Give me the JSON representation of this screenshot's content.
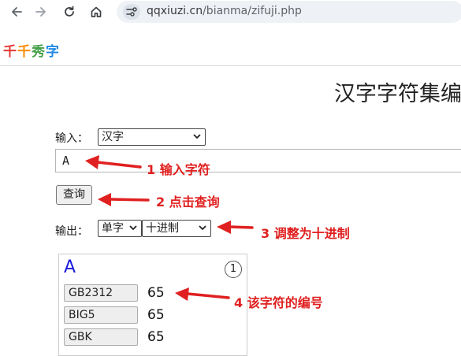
{
  "browser": {
    "url_host": "qqxiuzi.cn",
    "url_path": "/bianma/zifuji.php"
  },
  "site": {
    "logo_chars": [
      {
        "ch": "千",
        "color": "#e53935"
      },
      {
        "ch": "千",
        "color": "#fb8c00"
      },
      {
        "ch": "秀",
        "color": "#43a047"
      },
      {
        "ch": "字",
        "color": "#1e88e5"
      }
    ],
    "page_title": "汉字字符集编"
  },
  "form": {
    "input_label": "输入：",
    "input_type_value": "汉字",
    "input_value": "A",
    "query_button": "查询",
    "output_label": "输出：",
    "output_mode_value": "单字",
    "output_base_value": "十进制"
  },
  "result": {
    "char": "A",
    "index": "1",
    "codes": [
      {
        "name": "GB2312",
        "value": "65"
      },
      {
        "name": "BIG5",
        "value": "65"
      },
      {
        "name": "GBK",
        "value": "65"
      }
    ]
  },
  "annotations": {
    "step1": "1 输入字符",
    "step2": "2 点击查询",
    "step3": "3 调整为十进制",
    "step4": "4 该字符的编号",
    "color": "#e02020"
  }
}
